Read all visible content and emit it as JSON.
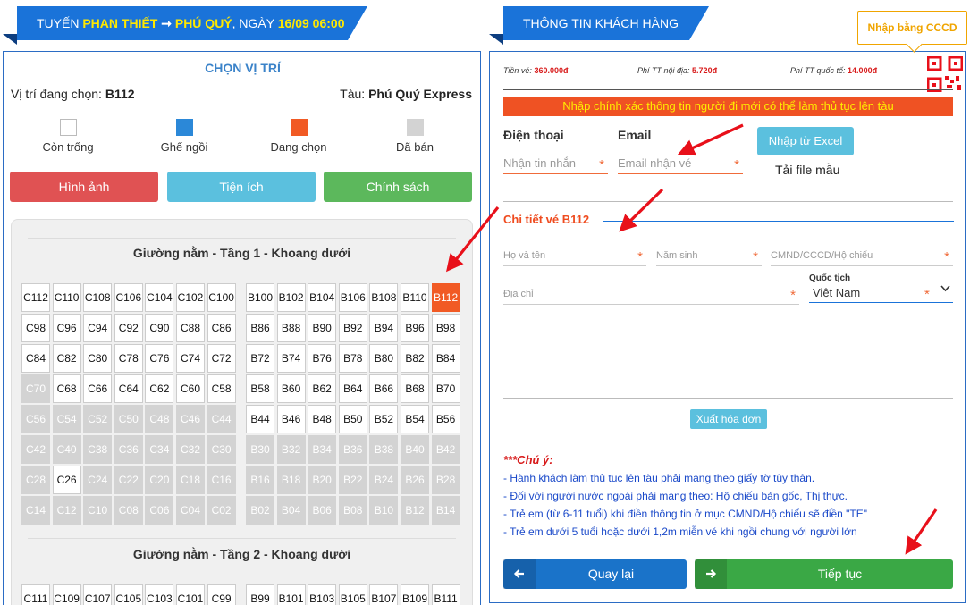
{
  "route_header": {
    "prefix": "TUYẾN",
    "from": "PHAN THIẾT",
    "arrow": "➞",
    "to": "PHÚ QUÝ",
    "date_prefix": ", NGÀY",
    "date": "16/09 06:00"
  },
  "seat_panel": {
    "title": "CHỌN VỊ TRÍ",
    "position_label": "Vị trí đang chọn:",
    "position_value": "B112",
    "ship_label": "Tàu:",
    "ship_value": "Phú Quý Express",
    "legend": [
      {
        "label": "Còn trống",
        "color": "#ffffff"
      },
      {
        "label": "Ghế ngồi",
        "color": "#2b88d8"
      },
      {
        "label": "Đang chọn",
        "color": "#f15a24"
      },
      {
        "label": "Đã bán",
        "color": "#d3d3d3"
      }
    ],
    "buttons": [
      {
        "label": "Hình ảnh",
        "color": "#e05253"
      },
      {
        "label": "Tiện ích",
        "color": "#5bc0de"
      },
      {
        "label": "Chính sách",
        "color": "#5cb85c"
      }
    ],
    "deck1_title": "Giường nằm - Tầng 1 - Khoang dưới",
    "deck1_rows": [
      {
        "left": [
          "C112",
          "C110",
          "C108",
          "C106",
          "C104",
          "C102",
          "C100"
        ],
        "right": [
          "B100",
          "B102",
          "B104",
          "B106",
          "B108",
          "B110",
          "B112"
        ]
      },
      {
        "left": [
          "C98",
          "C96",
          "C94",
          "C92",
          "C90",
          "C88",
          "C86"
        ],
        "right": [
          "B86",
          "B88",
          "B90",
          "B92",
          "B94",
          "B96",
          "B98"
        ]
      },
      {
        "left": [
          "C84",
          "C82",
          "C80",
          "C78",
          "C76",
          "C74",
          "C72"
        ],
        "right": [
          "B72",
          "B74",
          "B76",
          "B78",
          "B80",
          "B82",
          "B84"
        ]
      },
      {
        "left": [
          "C70",
          "C68",
          "C66",
          "C64",
          "C62",
          "C60",
          "C58"
        ],
        "right": [
          "B58",
          "B60",
          "B62",
          "B64",
          "B66",
          "B68",
          "B70"
        ]
      },
      {
        "left": [
          "C56",
          "C54",
          "C52",
          "C50",
          "C48",
          "C46",
          "C44"
        ],
        "right": [
          "B44",
          "B46",
          "B48",
          "B50",
          "B52",
          "B54",
          "B56"
        ]
      },
      {
        "left": [
          "C42",
          "C40",
          "C38",
          "C36",
          "C34",
          "C32",
          "C30"
        ],
        "right": [
          "B30",
          "B32",
          "B34",
          "B36",
          "B38",
          "B40",
          "B42"
        ]
      },
      {
        "left": [
          "C28",
          "C26",
          "C24",
          "C22",
          "C20",
          "C18",
          "C16"
        ],
        "right": [
          "B16",
          "B18",
          "B20",
          "B22",
          "B24",
          "B26",
          "B28"
        ]
      },
      {
        "left": [
          "C14",
          "C12",
          "C10",
          "C08",
          "C06",
          "C04",
          "C02"
        ],
        "right": [
          "B02",
          "B04",
          "B06",
          "B08",
          "B10",
          "B12",
          "B14"
        ]
      }
    ],
    "deck1_sold": [
      "C70",
      "C56",
      "C54",
      "C52",
      "C50",
      "C48",
      "C46",
      "C44",
      "C42",
      "C40",
      "C38",
      "C36",
      "C34",
      "C32",
      "C30",
      "B30",
      "B32",
      "B34",
      "B36",
      "B38",
      "B40",
      "B42",
      "C28",
      "C24",
      "C22",
      "C20",
      "C18",
      "C16",
      "B16",
      "B18",
      "B20",
      "B22",
      "B24",
      "B26",
      "B28",
      "C14",
      "C12",
      "C10",
      "C08",
      "C06",
      "C04",
      "C02",
      "B02",
      "B04",
      "B06",
      "B08",
      "B10",
      "B12",
      "B14"
    ],
    "selected": "B112",
    "deck2_title": "Giường nằm - Tầng 2 - Khoang dưới",
    "deck2_rows": [
      {
        "left": [
          "C111",
          "C109",
          "C107",
          "C105",
          "C103",
          "C101",
          "C99"
        ],
        "right": [
          "B99",
          "B101",
          "B103",
          "B105",
          "B107",
          "B109",
          "B111"
        ]
      }
    ]
  },
  "customer_header": {
    "title": "THÔNG TIN KHÁCH HÀNG"
  },
  "cccd_button": "Nhập bằng CCCD",
  "fees": [
    {
      "label": "Tiền vé:",
      "value": "360.000đ"
    },
    {
      "label": "Phí TT nội địa:",
      "value": "5.720đ"
    },
    {
      "label": "Phí TT quốc tế:",
      "value": "14.000đ"
    }
  ],
  "warning": "Nhập chính xác thông tin người đi mới có thể làm thủ tục lên tàu",
  "contact": {
    "phone_label": "Điện thoại",
    "phone_placeholder": "Nhận tin nhắn",
    "email_label": "Email",
    "email_placeholder": "Email nhận vé",
    "excel_button": "Nhập từ Excel",
    "sample_link": "Tải file mẫu"
  },
  "ticket_detail": {
    "title": "Chi tiết vé B112",
    "name_placeholder": "Họ và tên",
    "birth_placeholder": "Năm sinh",
    "id_placeholder": "CMND/CCCD/Hộ chiếu",
    "address_placeholder": "Địa chỉ",
    "nationality_label": "Quốc tịch",
    "nationality_value": "Việt Nam"
  },
  "invoice_button": "Xuất hóa đơn",
  "notes": {
    "title": "***Chú ý:",
    "items": [
      "- Hành khách làm thủ tục lên tàu phải mang theo giấy tờ tùy thân.",
      "- Đối với người nước ngoài phải mang theo: Hộ chiếu bản gốc, Thị thực.",
      "- Trẻ em (từ 6-11 tuổi) khi điền thông tin ở mục CMND/Hộ chiếu sẽ điền \"TE\"",
      "- Trẻ em dưới 5 tuổi hoặc dưới 1,2m miễn vé khi ngồi chung với người lớn"
    ]
  },
  "nav": {
    "back_label": "Quay lại",
    "back_color": "#1a73c9",
    "next_label": "Tiếp tục",
    "next_color": "#3aa845"
  },
  "icons": {
    "back": "arrow-left-icon",
    "next": "arrow-right-icon",
    "qr": "qr-code-icon",
    "select": "chevron-down-icon"
  },
  "annotation_color": "#e8101a"
}
